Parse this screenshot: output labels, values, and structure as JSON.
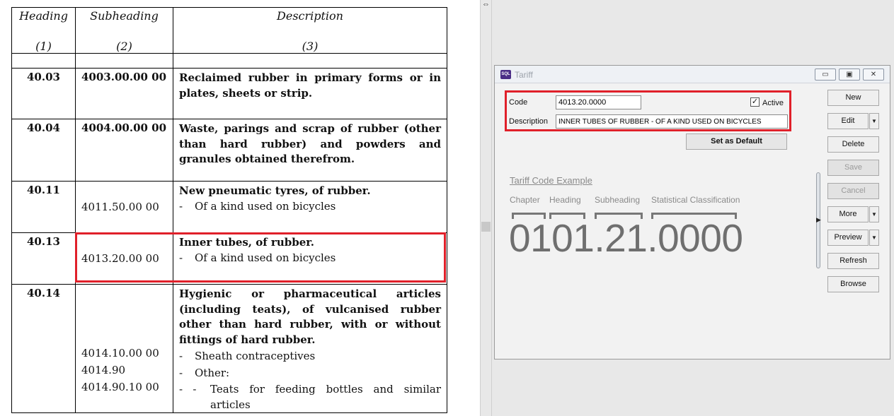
{
  "document": {
    "headers": [
      {
        "title": "Heading",
        "num": "(1)"
      },
      {
        "title": "Subheading",
        "num": "(2)"
      },
      {
        "title": "Description",
        "num": "(3)"
      }
    ],
    "rows": [
      {
        "heading": "40.03",
        "subheading_bold": "4003.00.00 00",
        "title": "Reclaimed rubber in primary forms or in plates, sheets or strip."
      },
      {
        "heading": "40.04",
        "subheading_bold": "4004.00.00 00",
        "title": "Waste, parings and scrap of rubber (other than hard rubber) and powders and granules obtained therefrom."
      },
      {
        "heading": "40.11",
        "title": "New pneumatic tyres, of rubber.",
        "items": [
          {
            "code": "4011.50.00 00",
            "dash": "-",
            "text": "Of a kind used on bicycles"
          }
        ]
      },
      {
        "heading": "40.13",
        "title": "Inner tubes, of rubber.",
        "items": [
          {
            "code": "4013.20.00 00",
            "dash": "-",
            "text": "Of a kind used on bicycles"
          }
        ]
      },
      {
        "heading": "40.14",
        "title": "Hygienic or pharmaceutical articles (including teats), of vulcanised rubber other than hard rubber, with or without fittings of hard rubber.",
        "items": [
          {
            "code": "4014.10.00 00",
            "dash": "-",
            "text": "Sheath contraceptives"
          },
          {
            "code": "4014.90",
            "dash": "-",
            "text": "Other:"
          },
          {
            "code": "4014.90.10 00",
            "dash": "-   -",
            "text": "Teats for feeding bottles and similar articles"
          }
        ]
      }
    ]
  },
  "window": {
    "title": "Tariff",
    "app_icon_text": "SQL",
    "controls": {
      "minimize": "▭",
      "maximize": "▣",
      "close": "✕"
    },
    "form": {
      "code_label": "Code",
      "code_value": "4013.20.0000",
      "active_label": "Active",
      "active_checked": true,
      "active_mark": "✓",
      "description_label": "Description",
      "description_value": "INNER TUBES OF RUBBER - OF A KIND USED ON BICYCLES",
      "set_default_label": "Set as Default"
    },
    "example": {
      "title": "Tariff Code Example",
      "chapter": "Chapter",
      "heading": "Heading",
      "subheading": "Subheading",
      "statistical": "Statistical Classification",
      "code": "0101.21.0000"
    },
    "side_arrow": "▶",
    "buttons": {
      "new": "New",
      "edit": "Edit",
      "delete": "Delete",
      "save": "Save",
      "cancel": "Cancel",
      "more": "More",
      "preview": "Preview",
      "refresh": "Refresh",
      "browse": "Browse",
      "dropdown": "▼"
    }
  },
  "splitter": {
    "arrows": "⇔"
  },
  "colors": {
    "highlight": "#e0202a",
    "window_bg": "#f2f2f2",
    "example_text": "#6f6f6f"
  }
}
